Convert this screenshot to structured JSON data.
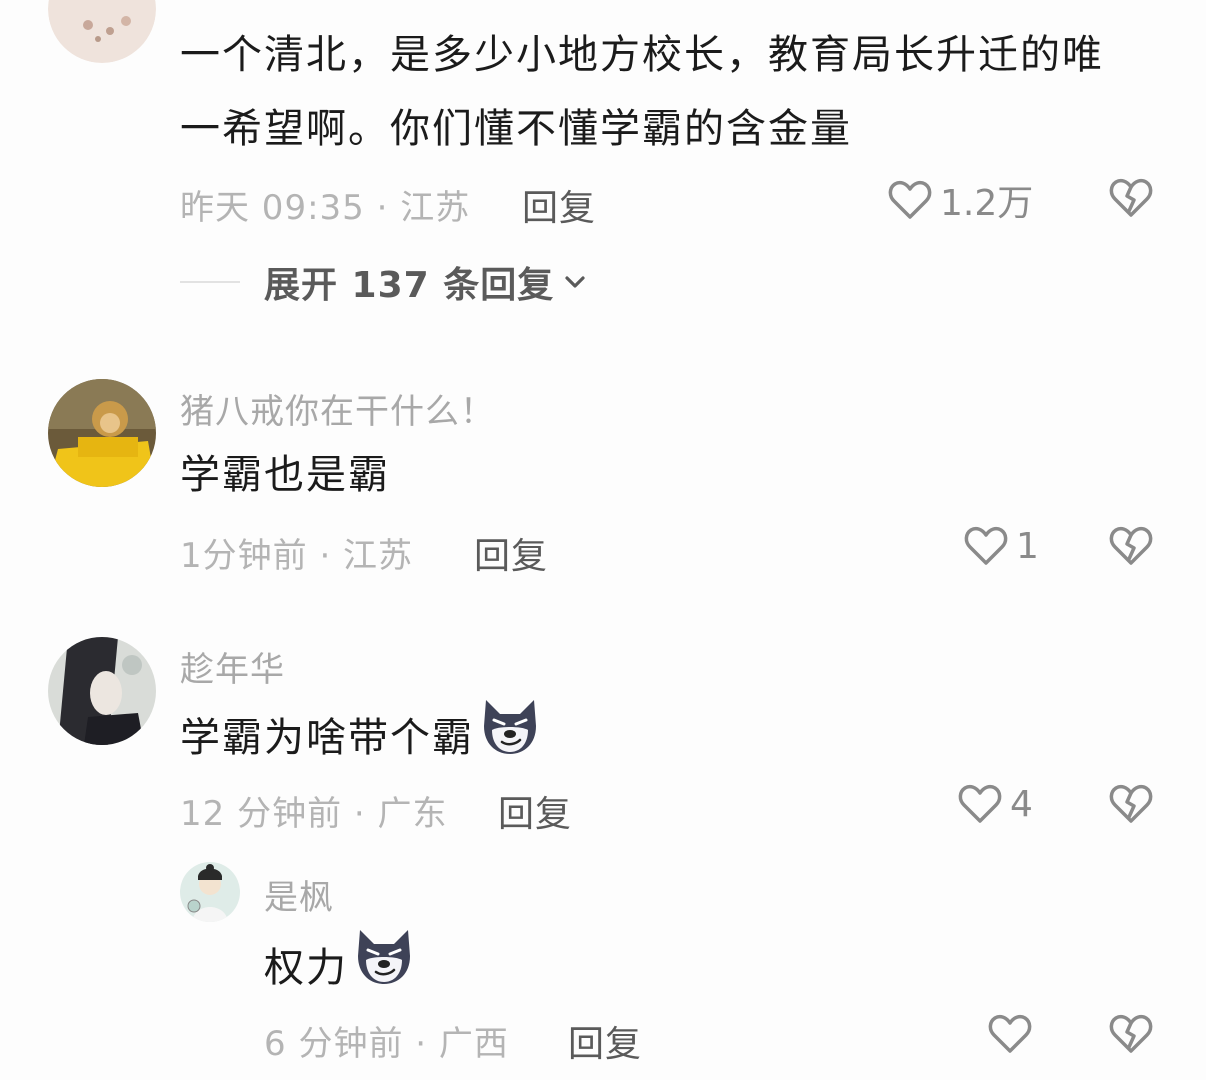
{
  "comments": [
    {
      "text_line1": "一个清北，是多少小地方校长，教育局长升迁的唯",
      "text_line2": "一希望啊。你们懂不懂学霸的含金量",
      "meta": "昨天 09:35 · 江苏",
      "reply_label": "回复",
      "like_count": "1.2万",
      "expand_label": "展开 137 条回复"
    },
    {
      "username": "猪八戒你在干什么！",
      "text": "学霸也是霸",
      "meta": "1分钟前 · 江苏",
      "reply_label": "回复",
      "like_count": "1"
    },
    {
      "username": "趁年华",
      "text": "学霸为啥带个霸",
      "emoji": "husky-smirk-emoji",
      "meta": "12 分钟前 · 广东",
      "reply_label": "回复",
      "like_count": "4"
    },
    {
      "username": "是枫",
      "text": "权力",
      "emoji": "husky-smirk-emoji",
      "meta": "6 分钟前 · 广西",
      "reply_label": "回复",
      "like_count": ""
    }
  ],
  "icons": {
    "like": "heart-outline-icon",
    "dislike": "broken-heart-icon",
    "expand": "chevron-down-icon"
  },
  "colors": {
    "text": "#1b1b1b",
    "meta": "#b4b4b4",
    "username": "#a8a8a8",
    "icon": "#8a8a8a"
  }
}
